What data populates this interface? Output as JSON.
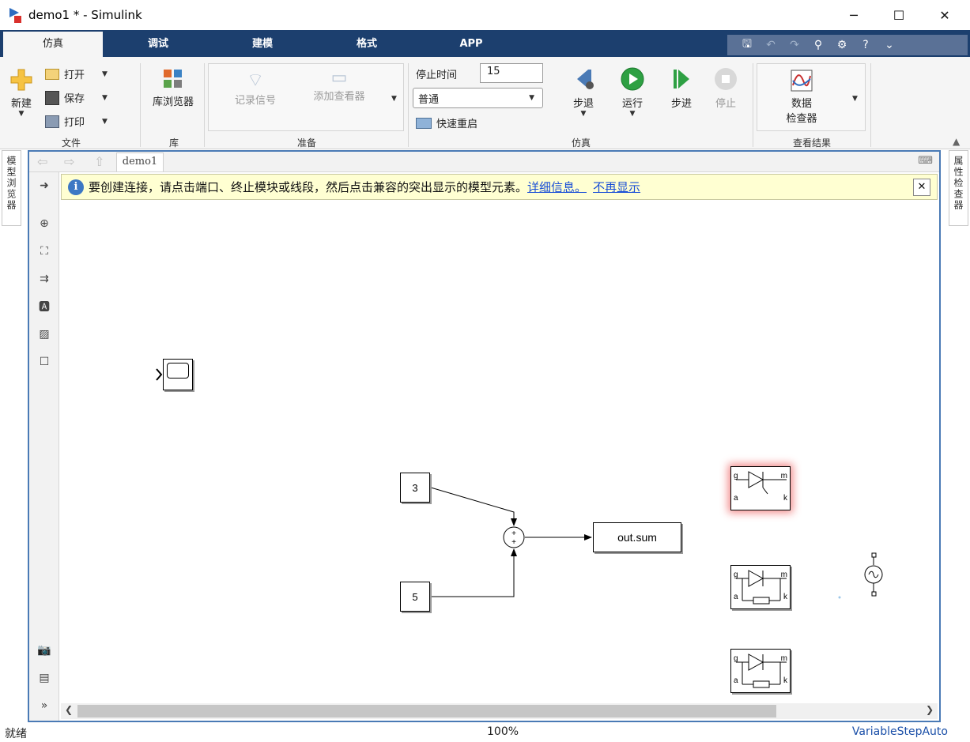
{
  "window": {
    "title": "demo1 * - Simulink",
    "minimize": "─",
    "maximize": "☐",
    "close": "✕"
  },
  "tabs": [
    {
      "label": "仿真"
    },
    {
      "label": "调试"
    },
    {
      "label": "建模"
    },
    {
      "label": "格式"
    },
    {
      "label": "APP"
    }
  ],
  "ribbon": {
    "file": {
      "new_label": "新建",
      "open_label": "打开",
      "save_label": "保存",
      "print_label": "打印",
      "group_label": "文件"
    },
    "library": {
      "browser_label": "库浏览器",
      "group_label": "库"
    },
    "prepare": {
      "log_signal_label": "记录信号",
      "add_viewer_label": "添加查看器",
      "group_label": "准备"
    },
    "simulate": {
      "stop_time_label": "停止时间",
      "stop_time_value": "15",
      "mode_value": "普通",
      "fast_restart_label": "快速重启",
      "step_back_label": "步退",
      "run_label": "运行",
      "step_forward_label": "步进",
      "stop_label": "停止",
      "group_label": "仿真"
    },
    "review": {
      "data_inspector_line1": "数据",
      "data_inspector_line2": "检查器",
      "group_label": "查看结果"
    }
  },
  "side_panels": {
    "left": "模型浏览器",
    "right": "属性检查器"
  },
  "breadcrumb": {
    "model": "demo1"
  },
  "infobar": {
    "message": "要创建连接，请点击端口、终止模块或线段，然后点击兼容的突出显示的模型元素。",
    "link_details": "详细信息。",
    "link_dismiss": "不再显示",
    "close": "✕"
  },
  "diagram": {
    "const1_value": "3",
    "const2_value": "5",
    "sum_sign1": "+",
    "sum_sign2": "+",
    "out_label": "out.sum",
    "port_g": "g",
    "port_a": "a",
    "port_m": "m",
    "port_k": "k"
  },
  "status": {
    "left": "就绪",
    "zoom": "100%",
    "solver": "VariableStepAuto"
  }
}
